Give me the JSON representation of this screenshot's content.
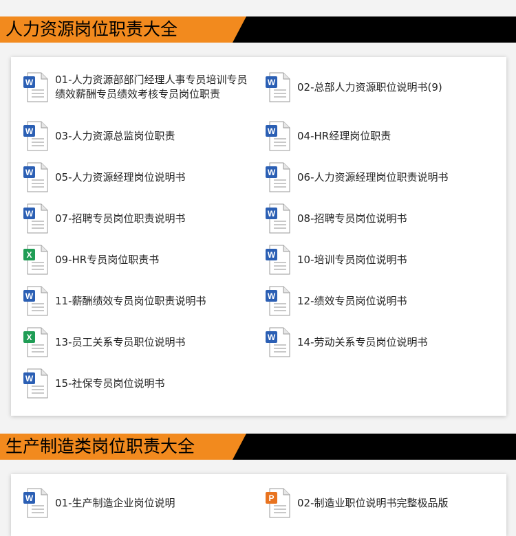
{
  "sections": [
    {
      "title": "人力资源岗位职责大全",
      "items": [
        {
          "label": "01-人力资源部部门经理人事专员培训专员绩效薪酬专员绩效考核专员岗位职责",
          "icon": "word-doc-icon"
        },
        {
          "label": "02-总部人力资源职位说明书(9)",
          "icon": "word-doc-icon"
        },
        {
          "label": "03-人力资源总监岗位职责",
          "icon": "word-doc-icon"
        },
        {
          "label": "04-HR经理岗位职责",
          "icon": "word-doc-icon"
        },
        {
          "label": "05-人力资源经理岗位说明书",
          "icon": "word-doc-icon"
        },
        {
          "label": "06-人力资源经理岗位职责说明书",
          "icon": "word-doc-icon"
        },
        {
          "label": "07-招聘专员岗位职责说明书",
          "icon": "word-doc-icon"
        },
        {
          "label": "08-招聘专员岗位说明书",
          "icon": "word-doc-icon"
        },
        {
          "label": "09-HR专员岗位职责书",
          "icon": "excel-sheet-icon"
        },
        {
          "label": "10-培训专员岗位说明书",
          "icon": "word-doc-icon"
        },
        {
          "label": "11-薪酬绩效专员岗位职责说明书",
          "icon": "word-doc-icon"
        },
        {
          "label": "12-绩效专员岗位说明书",
          "icon": "word-doc-icon"
        },
        {
          "label": "13-员工关系专员职位说明书",
          "icon": "excel-sheet-icon"
        },
        {
          "label": "14-劳动关系专员岗位说明书",
          "icon": "word-doc-icon"
        },
        {
          "label": "15-社保专员岗位说明书",
          "icon": "word-doc-icon"
        }
      ]
    },
    {
      "title": "生产制造类岗位职责大全",
      "items": [
        {
          "label": "01-生产制造企业岗位说明",
          "icon": "word-doc-icon"
        },
        {
          "label": "02-制造业职位说明书完整极品版",
          "icon": "powerpoint-icon"
        }
      ]
    }
  ],
  "colors": {
    "accent": "#f28a1e",
    "banner": "#000000",
    "word": "#2b5fb4",
    "excel": "#1f9d55",
    "ppt": "#e8731f"
  }
}
